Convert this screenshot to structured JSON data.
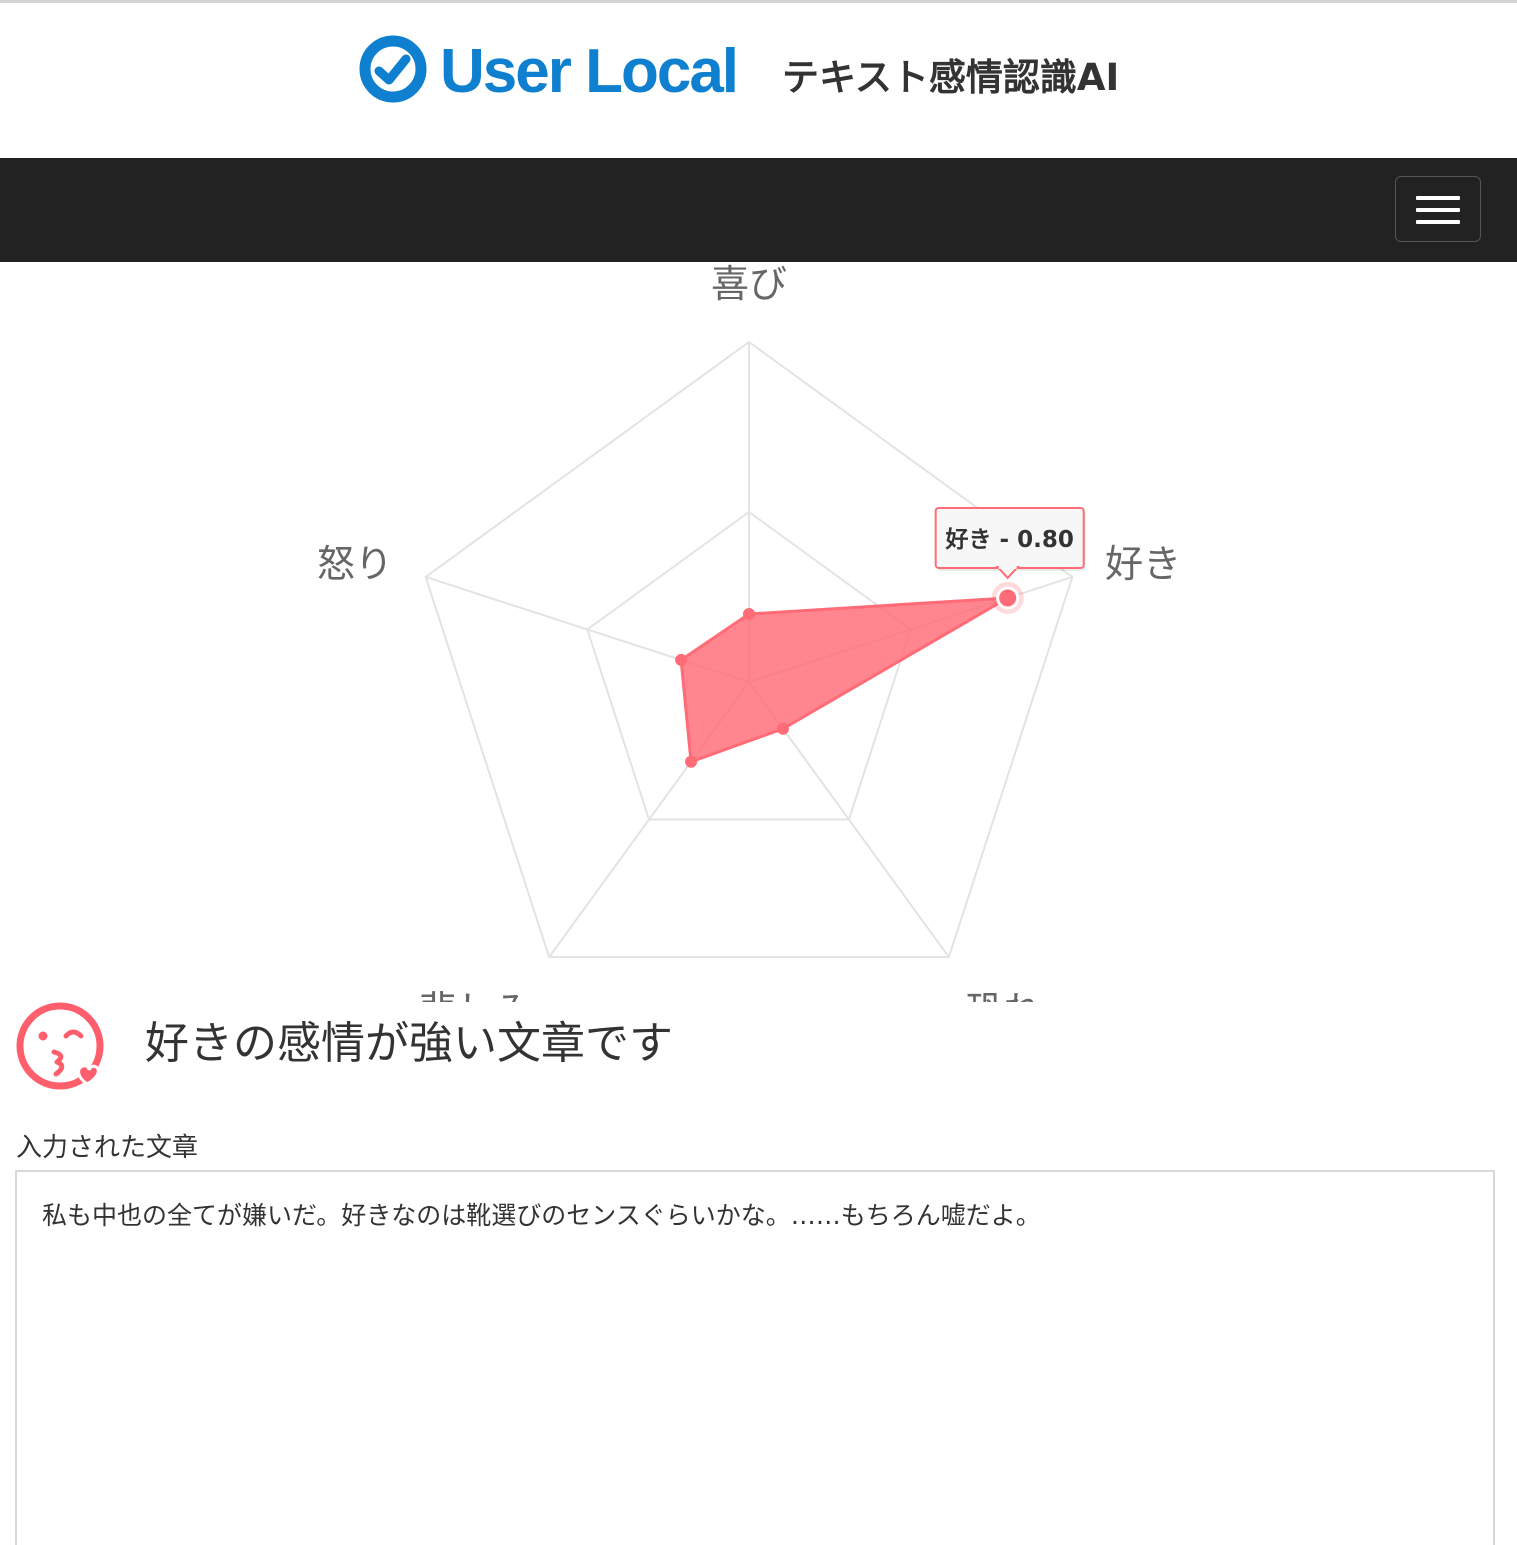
{
  "header": {
    "brand": "User Local",
    "product": "テキスト感情認識AI"
  },
  "navbar": {
    "menu_icon": "hamburger-menu-icon"
  },
  "chart_data": {
    "type": "radar",
    "axes": [
      "喜び",
      "好き",
      "恐れ",
      "悲しみ",
      "怒り"
    ],
    "series": [
      {
        "values": [
          0.2,
          0.8,
          0.17,
          0.29,
          0.21
        ]
      }
    ],
    "range": [
      0,
      1
    ],
    "tooltip": {
      "axis": "好き",
      "text": "好き - 0.80"
    },
    "fill_color": "#ff6b76",
    "grid": true
  },
  "result": {
    "icon": "kiss-face-icon",
    "heading": "好きの感情が強い文章です"
  },
  "input": {
    "label": "入力された文章",
    "text": "私も中也の全てが嫌いだ。好きなのは靴選びのセンスぐらいかな。……もちろん嘘だよ。"
  },
  "colors": {
    "brand": "#0f7fd0",
    "navbar": "#222222",
    "accent": "#ff6b76"
  }
}
